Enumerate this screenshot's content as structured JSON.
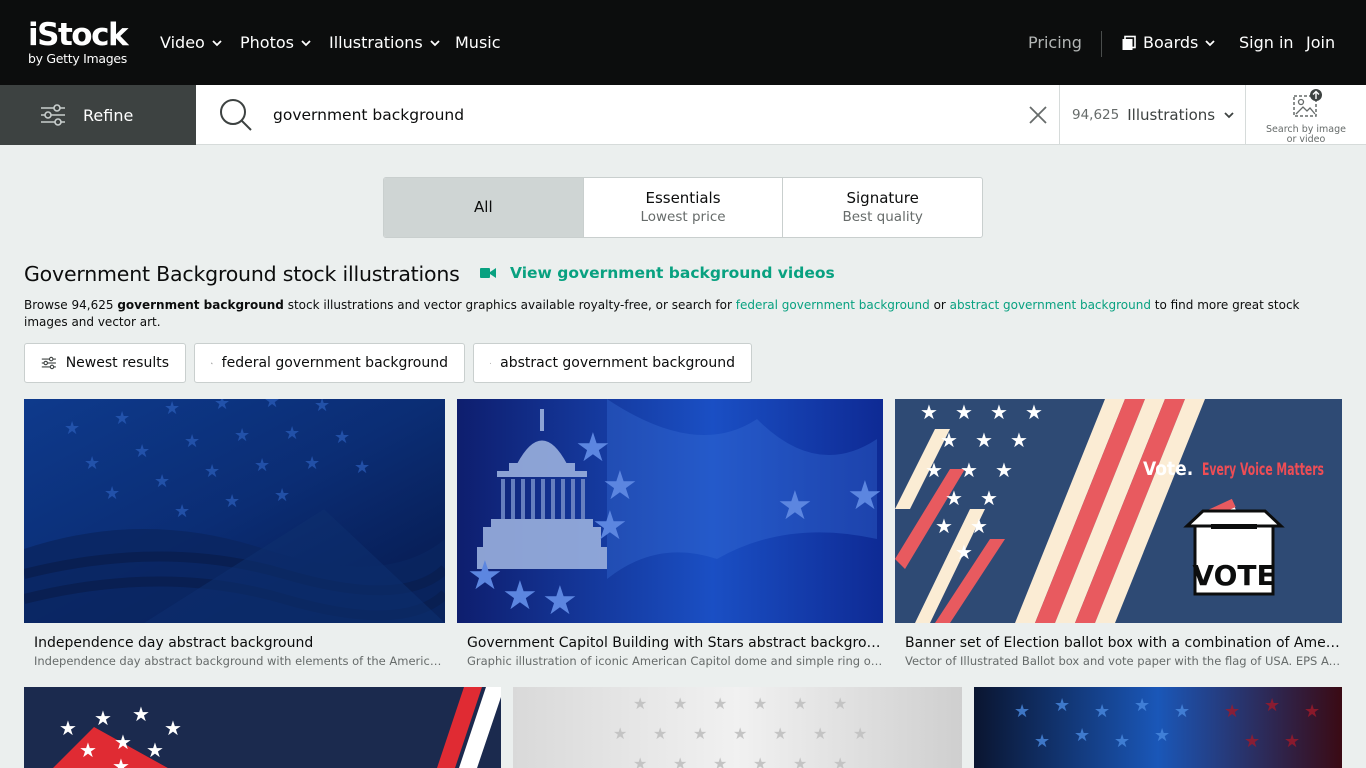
{
  "nav": {
    "logo_main": "iStock",
    "logo_sub": "by Getty Images",
    "items": [
      {
        "label": "Video",
        "dropdown": true
      },
      {
        "label": "Photos",
        "dropdown": true
      },
      {
        "label": "Illustrations",
        "dropdown": true
      },
      {
        "label": "Music",
        "dropdown": false
      }
    ],
    "pricing": "Pricing",
    "boards": "Boards",
    "sign_in": "Sign in",
    "join": "Join"
  },
  "search": {
    "refine_label": "Refine",
    "query": "government background",
    "result_count": "94,625",
    "media_type": "Illustrations",
    "image_search_caption": "Search by image or video"
  },
  "tabs": [
    {
      "label": "All",
      "sub": "",
      "active": true
    },
    {
      "label": "Essentials",
      "sub": "Lowest price",
      "active": false
    },
    {
      "label": "Signature",
      "sub": "Best quality",
      "active": false
    }
  ],
  "heading": {
    "title": "Government Background stock illustrations",
    "video_link": "View government background videos"
  },
  "description": {
    "part1": "Browse 94,625 ",
    "bold": "government background",
    "part2": " stock illustrations and vector graphics available royalty-free, or search for ",
    "link1": "federal government background",
    "part3": " or ",
    "link2": "abstract government background",
    "part4": " to find more great stock images and vector art."
  },
  "chips": [
    {
      "label": "Newest results",
      "icon": "sliders-icon"
    },
    {
      "label": "federal government background",
      "icon": "search-icon"
    },
    {
      "label": "abstract government background",
      "icon": "search-icon"
    }
  ],
  "results": [
    {
      "title": "Independence day abstract background",
      "description": "Independence day abstract background with elements of the American flag in dark blue colors"
    },
    {
      "title": "Government Capitol Building with Stars abstract background",
      "description": "Graphic illustration of iconic American Capitol dome and simple ring of stars"
    },
    {
      "title": "Banner set of Election ballot box with a combination of American flag",
      "description": "Vector of Illustrated Ballot box and vote paper with the flag of USA. EPS Adobe Illustrator"
    }
  ],
  "banner_text": {
    "vote": "Vote.",
    "every_voice": "Every Voice Matters",
    "vote_box": "VOTE"
  },
  "colors": {
    "nav_bg": "#0c0d0d",
    "accent_green": "#08a180",
    "page_bg": "#ebefee",
    "refine_bg": "#3d4241"
  }
}
